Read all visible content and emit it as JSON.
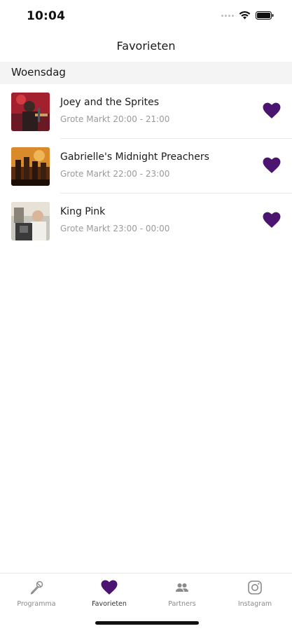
{
  "status_bar": {
    "time": "10:04"
  },
  "header": {
    "title": "Favorieten"
  },
  "section": {
    "day": "Woensdag"
  },
  "favorites": [
    {
      "title": "Joey and the Sprites",
      "location_time": "Grote Markt 20:00 - 21:00",
      "thumb_icon": "artist-photo"
    },
    {
      "title": "Gabrielle's Midnight Preachers",
      "location_time": "Grote Markt 22:00 - 23:00",
      "thumb_icon": "artist-photo"
    },
    {
      "title": "King Pink",
      "location_time": "Grote Markt 23:00 - 00:00",
      "thumb_icon": "artist-photo"
    }
  ],
  "tabs": [
    {
      "label": "Programma",
      "icon": "microphone-icon"
    },
    {
      "label": "Favorieten",
      "icon": "heart-icon"
    },
    {
      "label": "Partners",
      "icon": "people-icon"
    },
    {
      "label": "Instagram",
      "icon": "instagram-icon"
    }
  ],
  "colors": {
    "accent": "#4a1470",
    "tab_inactive": "#8a8a8a",
    "section_bg": "#f4f4f4"
  }
}
